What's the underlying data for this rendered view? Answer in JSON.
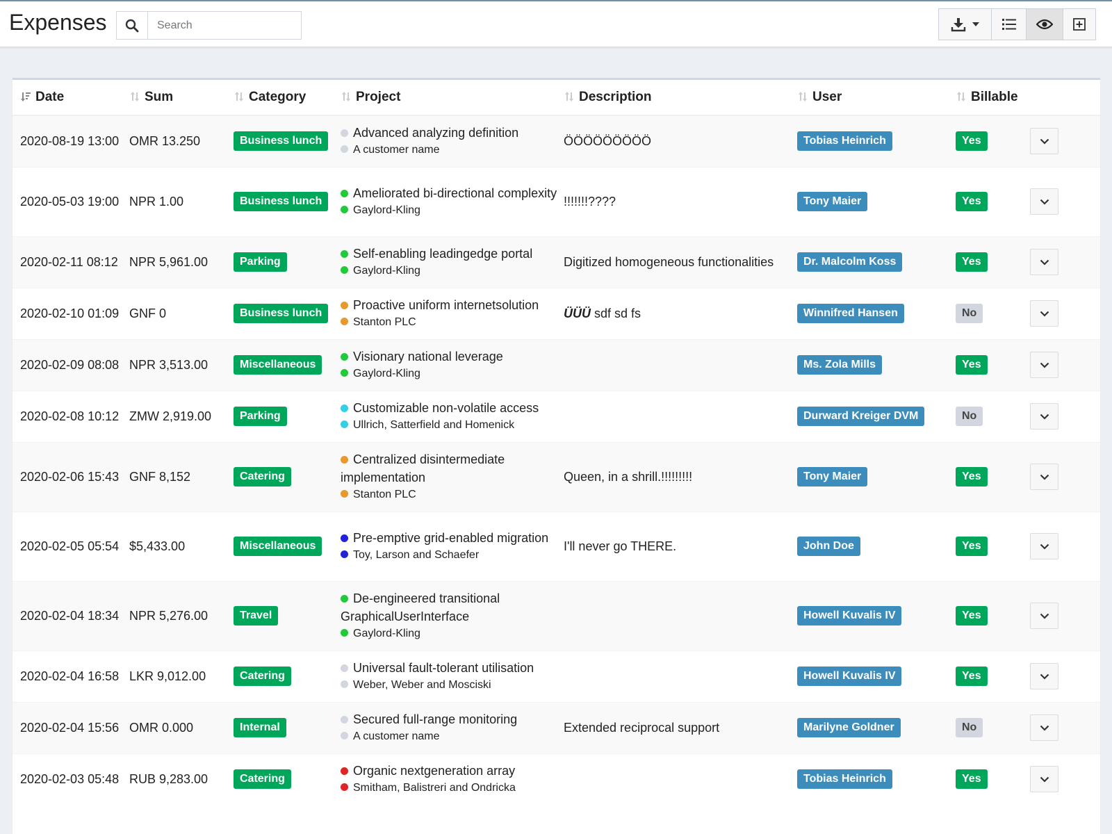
{
  "header": {
    "title": "Expenses",
    "search_placeholder": "Search"
  },
  "table": {
    "columns": [
      "Date",
      "Sum",
      "Category",
      "Project",
      "Description",
      "User",
      "Billable"
    ],
    "rows": [
      {
        "date": "2020-08-19 13:00",
        "sum": "OMR 13.250",
        "category": "Business lunch",
        "project": "Advanced analyzing definition",
        "customer": "A customer name",
        "project_color": "#d2d6de",
        "customer_color": "#d2d6de",
        "description": "ÖÖÖÖÖÖÖÖÖ",
        "user": "Tobias Heinrich",
        "billable": "Yes"
      },
      {
        "date": "2020-05-03 19:00",
        "sum": "NPR 1.00",
        "category": "Business lunch",
        "project": "Ameliorated bi-directional complexity",
        "customer": "Gaylord-Kling",
        "project_color": "#22c93a",
        "customer_color": "#22c93a",
        "description": "!!!!!!!????",
        "user": "Tony Maier",
        "billable": "Yes"
      },
      {
        "date": "2020-02-11 08:12",
        "sum": "NPR 5,961.00",
        "category": "Parking",
        "project": "Self-enabling leadingedge portal",
        "customer": "Gaylord-Kling",
        "project_color": "#22c93a",
        "customer_color": "#22c93a",
        "description": "Digitized homogeneous functionalities",
        "user": "Dr. Malcolm Koss",
        "billable": "Yes"
      },
      {
        "date": "2020-02-10 01:09",
        "sum": "GNF 0",
        "category": "Business lunch",
        "project": "Proactive uniform internetsolution",
        "customer": "Stanton PLC",
        "project_color": "#e69a2e",
        "customer_color": "#e69a2e",
        "description_bold": "ÜÜÜ",
        "description": " sdf sd fs",
        "user": "Winnifred Hansen",
        "billable": "No"
      },
      {
        "date": "2020-02-09 08:08",
        "sum": "NPR 3,513.00",
        "category": "Miscellaneous",
        "project": "Visionary national leverage",
        "customer": "Gaylord-Kling",
        "project_color": "#22c93a",
        "customer_color": "#22c93a",
        "description": "",
        "user": "Ms. Zola Mills",
        "billable": "Yes"
      },
      {
        "date": "2020-02-08 10:12",
        "sum": "ZMW 2,919.00",
        "category": "Parking",
        "project": "Customizable non-volatile access",
        "customer": "Ullrich, Satterfield and Homenick",
        "project_color": "#31d0e4",
        "customer_color": "#31d0e4",
        "description": "",
        "user": "Durward Kreiger DVM",
        "billable": "No"
      },
      {
        "date": "2020-02-06 15:43",
        "sum": "GNF 8,152",
        "category": "Catering",
        "project": "Centralized disintermediate implementation",
        "customer": "Stanton PLC",
        "project_color": "#e69a2e",
        "customer_color": "#e69a2e",
        "description": "Queen, in a shrill.!!!!!!!!!",
        "user": "Tony Maier",
        "billable": "Yes"
      },
      {
        "date": "2020-02-05 05:54",
        "sum": "$5,433.00",
        "category": "Miscellaneous",
        "project": "Pre-emptive grid-enabled migration",
        "customer": "Toy, Larson and Schaefer",
        "project_color": "#2222d8",
        "customer_color": "#2222d8",
        "description": "I'll never go THERE.",
        "user": "John Doe",
        "billable": "Yes"
      },
      {
        "date": "2020-02-04 18:34",
        "sum": "NPR 5,276.00",
        "category": "Travel",
        "project": "De-engineered transitional GraphicalUserInterface",
        "customer": "Gaylord-Kling",
        "project_color": "#22c93a",
        "customer_color": "#22c93a",
        "description": "",
        "user": "Howell Kuvalis IV",
        "billable": "Yes"
      },
      {
        "date": "2020-02-04 16:58",
        "sum": "LKR 9,012.00",
        "category": "Catering",
        "project": "Universal fault-tolerant utilisation",
        "customer": "Weber, Weber and Mosciski",
        "project_color": "#d2d6de",
        "customer_color": "#d2d6de",
        "description": "",
        "user": "Howell Kuvalis IV",
        "billable": "Yes"
      },
      {
        "date": "2020-02-04 15:56",
        "sum": "OMR 0.000",
        "category": "Internal",
        "project": "Secured full-range monitoring",
        "customer": "A customer name",
        "project_color": "#d2d6de",
        "customer_color": "#d2d6de",
        "description": "Extended reciprocal support",
        "user": "Marilyne Goldner",
        "billable": "No"
      },
      {
        "date": "2020-02-03 05:48",
        "sum": "RUB 9,283.00",
        "category": "Catering",
        "project": "Organic nextgeneration array",
        "customer": "Smitham, Balistreri and Ondricka",
        "project_color": "#e02424",
        "customer_color": "#e02424",
        "description": "",
        "user": "Tobias Heinrich",
        "billable": "Yes"
      }
    ]
  },
  "colors": {
    "label_green": "#00a65a",
    "label_blue": "#3c8dbc",
    "label_gray": "#d2d6de",
    "background": "#ecf0f5"
  },
  "icons": {
    "search": "search-icon",
    "download": "download-icon",
    "list": "list-icon",
    "eye": "eye-icon",
    "add": "add-icon",
    "dropdown": "chevron-down-icon"
  }
}
